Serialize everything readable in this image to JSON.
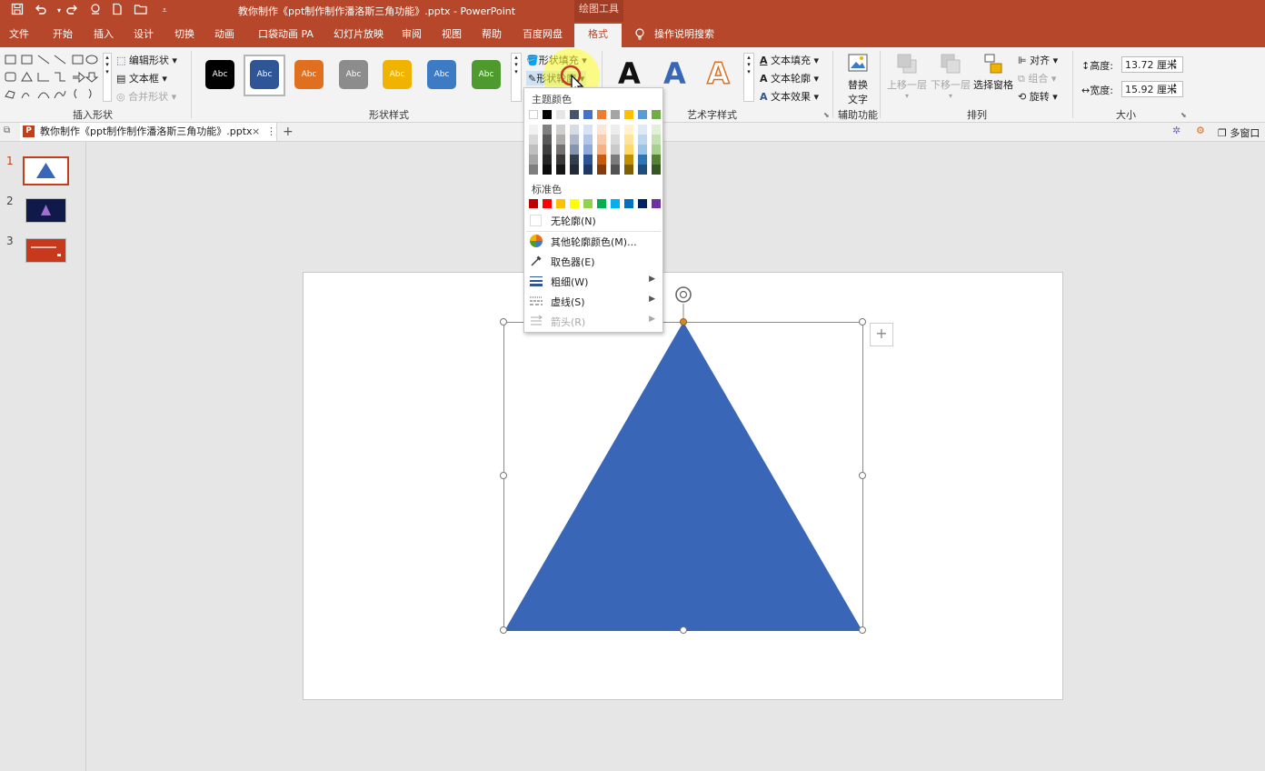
{
  "title_bar": {
    "title": "教你制作《ppt制作制作潘洛斯三角功能》.pptx  -  PowerPoint",
    "context_tab": "绘图工具",
    "quick_access": [
      "save-icon",
      "undo-icon",
      "redo-icon",
      "touch-mode-icon",
      "new-file-icon",
      "open-folder-icon",
      "customize-icon"
    ]
  },
  "tabs": [
    "文件",
    "开始",
    "插入",
    "设计",
    "切换",
    "动画",
    "口袋动画 PA",
    "幻灯片放映",
    "审阅",
    "视图",
    "帮助",
    "百度网盘",
    "格式"
  ],
  "active_tab": "格式",
  "tell_me": "操作说明搜索",
  "ribbon": {
    "insert_shapes": {
      "label": "插入形状",
      "edit_shape": "编辑形状",
      "text_box": "文本框",
      "merge_shapes": "合并形状"
    },
    "shape_styles": {
      "label": "形状样式",
      "swatch_text": "Abc",
      "swatch_colors": [
        "#000000",
        "#2f5597",
        "#e07020",
        "#8c8c8c",
        "#f0b400",
        "#3d7cc4",
        "#4f9a2e"
      ],
      "fill": "形状填充",
      "outline": "形状轮廓"
    },
    "wordart": {
      "label": "艺术字样式",
      "glyph": "A",
      "text_fill": "文本填充",
      "text_outline": "文本轮廓",
      "text_effects": "文本效果"
    },
    "accessibility": {
      "label": "辅助功能",
      "alt_text_line1": "替换",
      "alt_text_line2": "文字"
    },
    "arrange": {
      "label": "排列",
      "bring_forward": "上移一层",
      "send_backward": "下移一层",
      "selection_pane": "选择窗格",
      "align": "对齐",
      "group": "组合",
      "rotate": "旋转"
    },
    "size": {
      "label": "大小",
      "height_label": "高度:",
      "height_value": "13.72 厘米",
      "width_label": "宽度:",
      "width_value": "15.92 厘米"
    }
  },
  "doc_tab": {
    "name": "教你制作《ppt制作制作潘洛斯三角功能》.pptx",
    "close": "×",
    "more": "⋮",
    "add": "+",
    "right_label": "多窗口"
  },
  "slides": [
    {
      "number": "1"
    },
    {
      "number": "2"
    },
    {
      "number": "3"
    }
  ],
  "outline_menu": {
    "theme_colors_label": "主题颜色",
    "theme_top_row": [
      "#ffffff",
      "#000000",
      "#e7e6e6",
      "#44546a",
      "#4472c4",
      "#ed7d31",
      "#a5a5a5",
      "#ffc000",
      "#5b9bd5",
      "#70ad47"
    ],
    "theme_shades": [
      [
        "#f2f2f2",
        "#7f7f7f",
        "#d0cece",
        "#d6dce4",
        "#d9e2f3",
        "#fbe5d6",
        "#ededed",
        "#fff2cc",
        "#deebf6",
        "#e2efd9"
      ],
      [
        "#d9d9d9",
        "#595959",
        "#aeabab",
        "#adb9ca",
        "#b4c6e7",
        "#f7cbac",
        "#dbdbdb",
        "#fee599",
        "#bdd7ee",
        "#c5e0b3"
      ],
      [
        "#bfbfbf",
        "#3f3f3f",
        "#757070",
        "#8496b0",
        "#8eaadb",
        "#f4b183",
        "#c9c9c9",
        "#ffd966",
        "#9cc3e5",
        "#a8d08d"
      ],
      [
        "#a6a6a6",
        "#262626",
        "#3a3838",
        "#323f4f",
        "#2f5496",
        "#c55a11",
        "#7b7b7b",
        "#bf9000",
        "#2e75b5",
        "#538135"
      ],
      [
        "#7f7f7f",
        "#0d0d0d",
        "#161616",
        "#222a35",
        "#1f3864",
        "#833c0b",
        "#525252",
        "#7f6000",
        "#1e4e79",
        "#375623"
      ]
    ],
    "standard_colors_label": "标准色",
    "standard_colors": [
      "#c00000",
      "#ff0000",
      "#ffc000",
      "#ffff00",
      "#92d050",
      "#00b050",
      "#00b0f0",
      "#0070c0",
      "#002060",
      "#7030a0"
    ],
    "no_outline": "无轮廓(N)",
    "more_colors": "其他轮廓颜色(M)...",
    "eyedropper": "取色器(E)",
    "weight": "粗细(W)",
    "dashes": "虚线(S)",
    "arrows": "箭头(R)"
  },
  "shape": {
    "fill": "#3a66b8"
  }
}
